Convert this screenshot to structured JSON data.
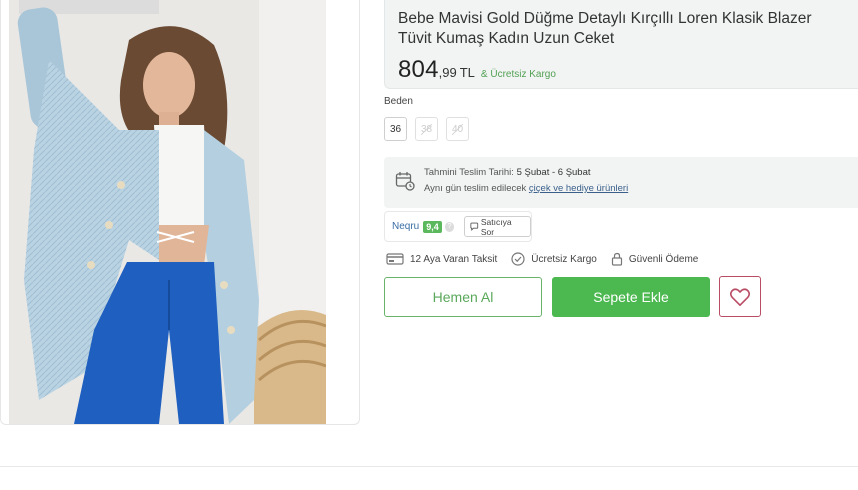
{
  "product": {
    "title_line1": "Bebe Mavisi Gold Düğme Detaylı Kırçıllı Loren Klasik Blazer",
    "title_line2": "Tüvit Kumaş Kadın Uzun Ceket",
    "price_main": "804",
    "price_decimal": ",99",
    "currency": "TL",
    "free_shipping": "& Ücretsiz Kargo",
    "image_icon": "product-photo"
  },
  "size": {
    "label": "Beden",
    "options": [
      {
        "label": "36",
        "available": true
      },
      {
        "label": "38",
        "available": false
      },
      {
        "label": "40",
        "available": false
      }
    ]
  },
  "delivery": {
    "icon": "calendar-truck-icon",
    "estimate_prefix": "Tahmini Teslim Tarihi: ",
    "estimate_dates": "5 Şubat - 6 Şubat",
    "same_day_prefix": "Aynı gün teslim edilecek ",
    "same_day_link": "çiçek ve hediye ürünleri"
  },
  "seller": {
    "name": "Neqru",
    "score": "9,4",
    "help_icon": "?",
    "ask_label": "Satıcıya Sor"
  },
  "features": [
    {
      "icon": "credit-card-icon",
      "label": "12 Aya Varan Taksit"
    },
    {
      "icon": "check-circle-icon",
      "label": "Ücretsiz Kargo"
    },
    {
      "icon": "lock-icon",
      "label": "Güvenli Ödeme"
    }
  ],
  "actions": {
    "buy_now": "Hemen Al",
    "add_to_cart": "Sepete Ekle",
    "favorite_icon": "heart-icon"
  },
  "colors": {
    "green": "#4cb850",
    "link_blue": "#3a6ea5",
    "fav_red": "#b94d66",
    "panel_grey": "#f2f4f4"
  }
}
